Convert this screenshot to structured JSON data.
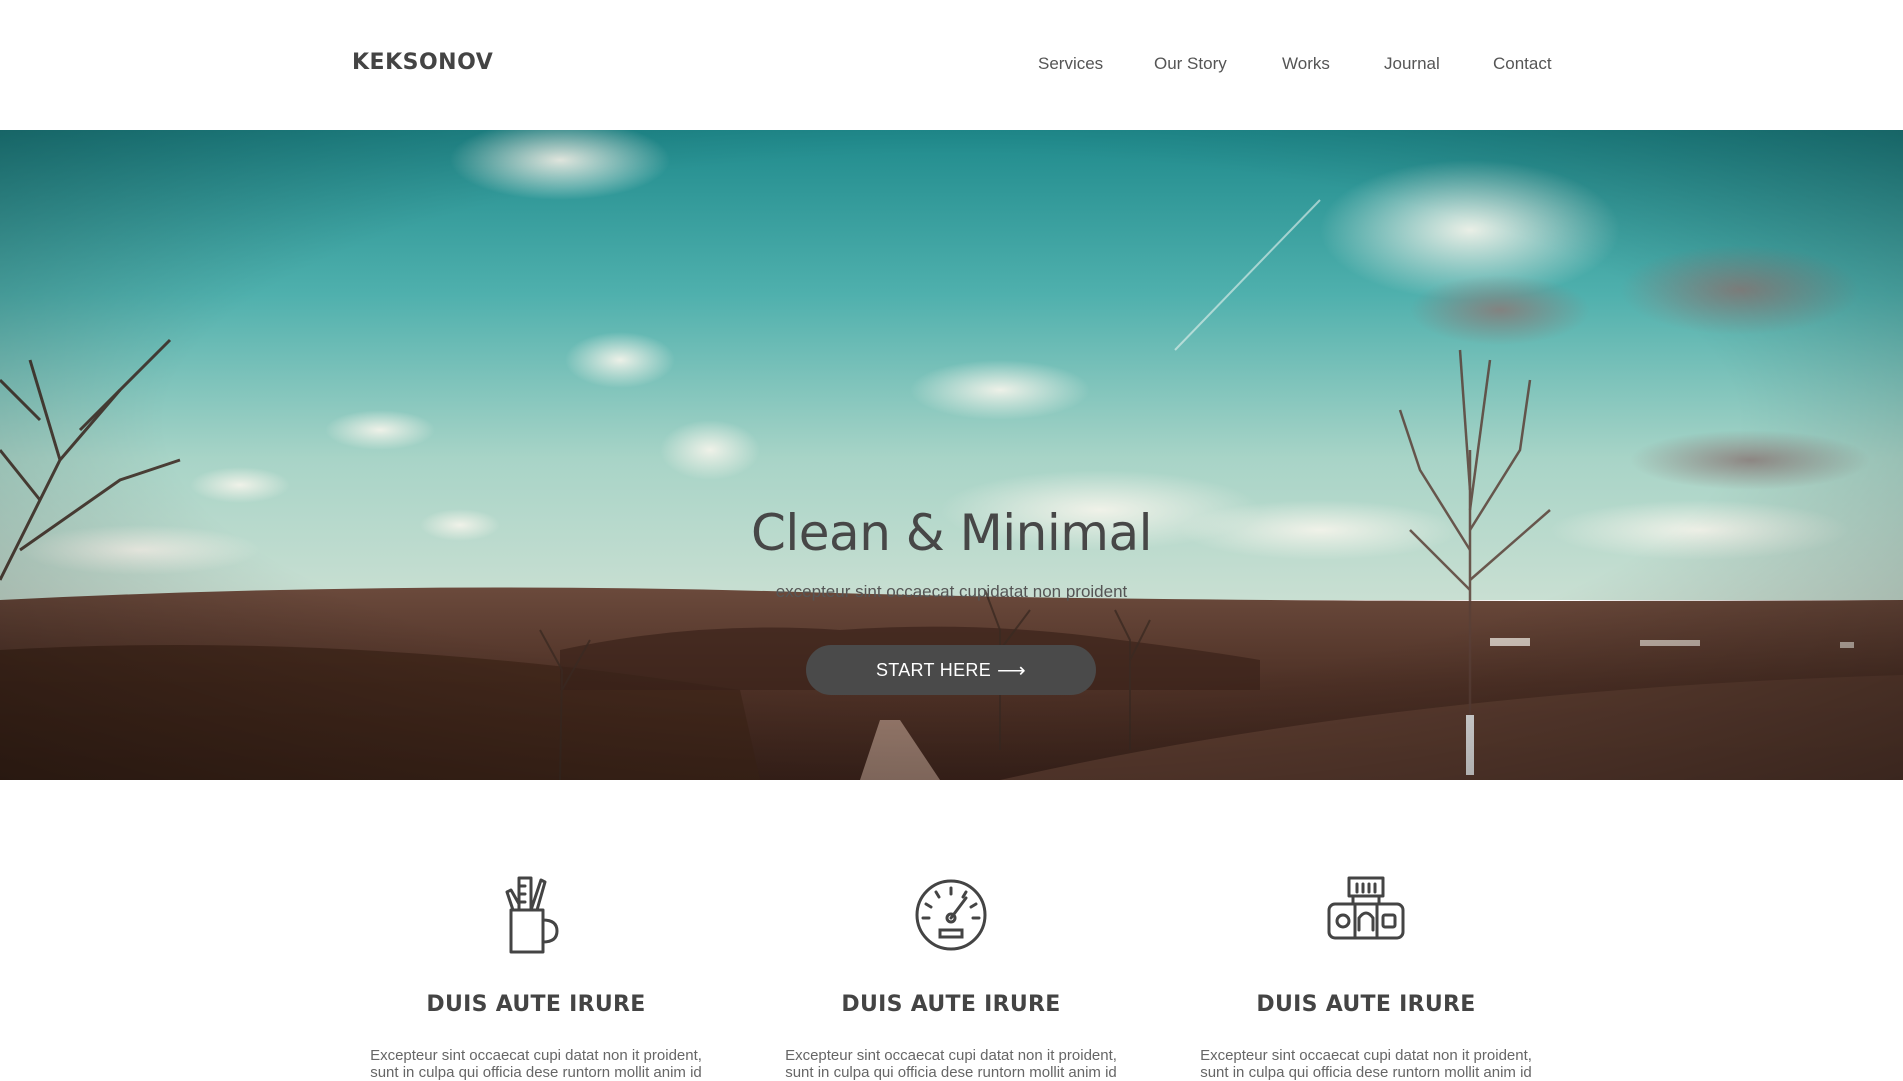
{
  "header": {
    "brand": "KEKSONOV",
    "nav": [
      "Services",
      "Our Story",
      "Works",
      "Journal",
      "Contact"
    ]
  },
  "hero": {
    "title": "Clean & Minimal",
    "subtitle": "excepteur sint occaecat cupidatat non proident",
    "button_label": "START HERE",
    "button_icon": "arrow-right-icon"
  },
  "features": [
    {
      "icon": "pencil-cup-icon",
      "title": "DUIS AUTE IRURE",
      "text": "Excepteur sint occaecat cupi datat non it proident, sunt in culpa qui officia dese runtorn mollit anim id"
    },
    {
      "icon": "speedometer-icon",
      "title": "DUIS AUTE IRURE",
      "text": "Excepteur sint occaecat cupi datat non it proident, sunt in culpa qui officia dese runtorn mollit anim id"
    },
    {
      "icon": "camera-icon",
      "title": "DUIS AUTE IRURE",
      "text": "Excepteur sint occaecat cupi datat non it proident, sunt in culpa qui officia dese runtorn mollit anim id"
    }
  ],
  "colors": {
    "text": "#444444",
    "button_bg": "#4a4a4a",
    "sky": "#5fb8b0",
    "field": "#5a3b2e"
  }
}
